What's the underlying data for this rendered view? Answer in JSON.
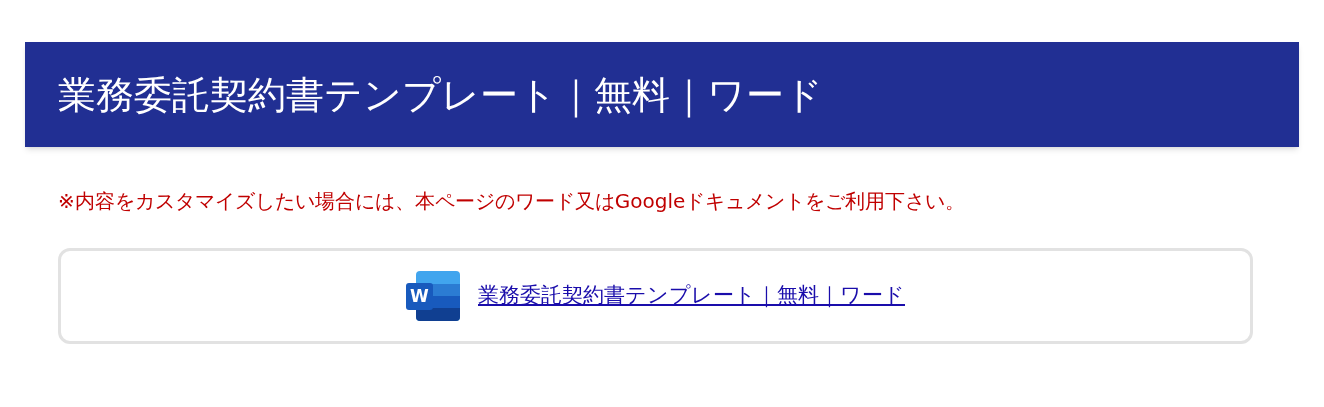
{
  "header": {
    "title": "業務委託契約書テンプレート｜無料｜ワード"
  },
  "notice": "※内容をカスタマイズしたい場合には、本ページのワード又はGoogleドキュメントをご利用下さい。",
  "download": {
    "icon_letter": "W",
    "link": "業務委託契約書テンプレート｜無料｜ワード"
  }
}
